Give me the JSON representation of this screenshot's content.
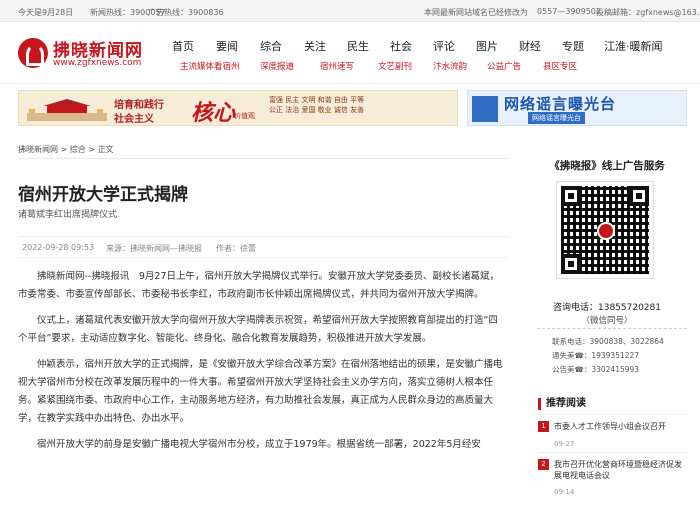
{
  "topbar": {
    "date": "今天是9月28日",
    "hotline1": "新闻热线：3900057",
    "hotline2": "广告热线：3900836",
    "notice": "本网最新网站域名已经修改为",
    "phone": "0557—3909502",
    "email": "投稿邮箱：zgfxnews@163.com"
  },
  "logo": {
    "name": "拂晓新闻网",
    "url": "www.zgfxnews.com"
  },
  "nav_main": [
    "首页",
    "要闻",
    "综合",
    "关注",
    "民生",
    "社会",
    "评论",
    "图片",
    "财经",
    "专题",
    "江淮·暖新闻"
  ],
  "nav_sub": [
    "主流媒体看宿州",
    "深度报道",
    "宿州速写",
    "文艺副刊",
    "汴水流韵",
    "公益广告",
    "县区专区"
  ],
  "banner_left": {
    "line1": "培育和践行",
    "line2": "社会主义",
    "big": "核心",
    "small": "价值观",
    "values": "富强 民主 文明 和谐 自由 平等 公正 法治 爱国 敬业 诚信 友善"
  },
  "banner_right": {
    "title": "网络谣言曝光台",
    "sub": "网络谣言曝光台"
  },
  "breadcrumb": "拂晓新闻网  >  综合  >  正文",
  "article": {
    "title": "宿州开放大学正式揭牌",
    "subtitle": "诸葛斌李红出席揭牌仪式",
    "date": "2022-09-28 09:53",
    "source": "来源：拂晓新闻网—拂晓报",
    "author": "作者：徐蕾",
    "paragraphs": [
      "拂晓新闻网--拂晓报讯　9月27日上午，宿州开放大学揭牌仪式举行。安徽开放大学党委委员、副校长诸葛斌，市委常委、市委宣传部部长、市委秘书长李红，市政府副市长仲颖出席揭牌仪式，并共同为宿州开放大学揭牌。",
      "仪式上，诸葛斌代表安徽开放大学向宿州开放大学揭牌表示祝贺，希望宿州开放大学按照教育部提出的打造“四个平台”要求，主动适应数字化、智能化、终身化、融合化教育发展趋势，积极推进开放大学发展。",
      "仲颖表示，宿州开放大学的正式揭牌，是《安徽开放大学综合改革方案》在宿州落地结出的硕果，是安徽广播电视大学宿州市分校在改革发展历程中的一件大事。希望宿州开放大学坚持社会主义办学方向，落实立德树人根本任务。紧紧围绕市委、市政府中心工作，主动服务地方经济，有力助推社会发展，真正成为人民群众身边的高质量大学，在教学实践中办出特色、办出水平。",
      "宿州开放大学的前身是安徽广播电视大学宿州市分校，成立于1979年。根据省统一部署，2022年5月经安"
    ]
  },
  "sidebar": {
    "ad_title": "《拂晓报》线上广告服务",
    "phone": "咨询电话：13855720281",
    "wechat": "（微信同号）",
    "contacts": [
      "联系电话：3900838、3022864",
      "通失美☎：1939351227",
      "公告美☎：3302415993"
    ],
    "rec_title": "推荐阅读",
    "rec_items": [
      {
        "num": "1",
        "text": "市委人才工作领导小组会议召开",
        "date": "09-27"
      },
      {
        "num": "2",
        "text": "我市召开优化营商环境暨稳经济促发展电视电话会议",
        "date": "09-14"
      }
    ]
  }
}
